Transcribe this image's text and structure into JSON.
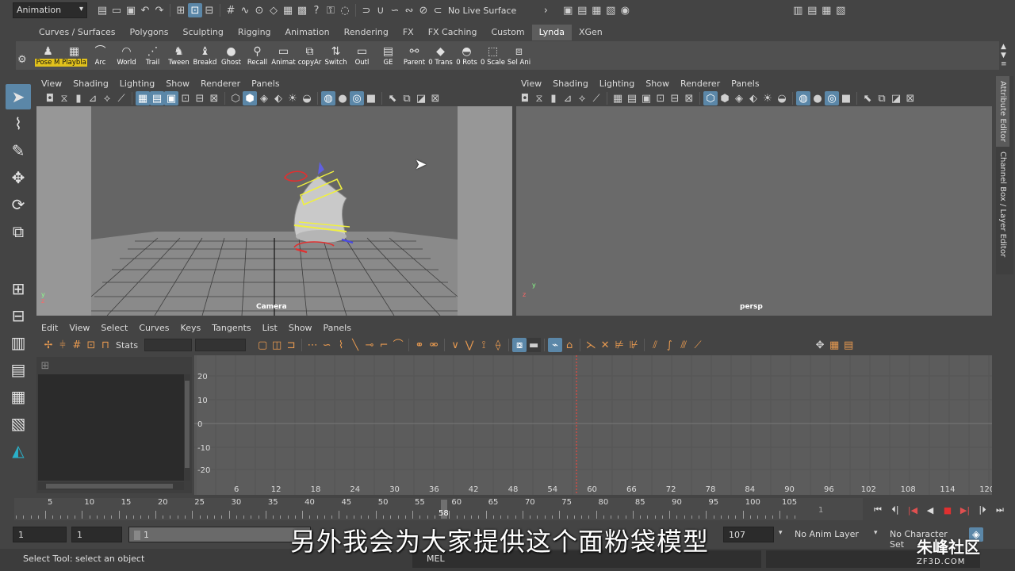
{
  "status_line": {
    "mode": "Animation",
    "live_surface": "No Live Surface"
  },
  "shelf": {
    "tabs": [
      "Curves / Surfaces",
      "Polygons",
      "Sculpting",
      "Rigging",
      "Animation",
      "Rendering",
      "FX",
      "FX Caching",
      "Custom",
      "Lynda",
      "XGen"
    ],
    "active_tab": "Lynda",
    "buttons": [
      "Pose M",
      "Playbla",
      "Arc",
      "World",
      "Trail",
      "Tween",
      "Breakd",
      "Ghost",
      "Recall",
      "Animat",
      "copyAr",
      "Switch",
      "Outl",
      "GE",
      "Parent",
      "0 Trans",
      "0 Rots",
      "0 Scale",
      "Sel Ani"
    ]
  },
  "left_panel": {
    "menu": [
      "View",
      "Shading",
      "Lighting",
      "Show",
      "Renderer",
      "Panels"
    ],
    "camera_label": "Camera"
  },
  "right_panel": {
    "menu": [
      "View",
      "Shading",
      "Lighting",
      "Show",
      "Renderer",
      "Panels"
    ],
    "camera_label": "persp"
  },
  "side_tabs": [
    "Attribute Editor",
    "Channel Box / Layer Editor"
  ],
  "graph_editor": {
    "menu": [
      "Edit",
      "View",
      "Select",
      "Curves",
      "Keys",
      "Tangents",
      "List",
      "Show",
      "Panels"
    ],
    "stats_label": "Stats",
    "y_labels": [
      "20",
      "10",
      "0",
      "-10",
      "-20"
    ],
    "x_labels": [
      "6",
      "12",
      "18",
      "24",
      "30",
      "36",
      "42",
      "48",
      "54",
      "60",
      "66",
      "72",
      "78",
      "84",
      "90",
      "96",
      "102",
      "108",
      "114",
      "120"
    ]
  },
  "time_slider": {
    "labels": [
      "5",
      "10",
      "15",
      "20",
      "25",
      "30",
      "35",
      "40",
      "45",
      "50",
      "55",
      "60",
      "65",
      "70",
      "75",
      "80",
      "85",
      "90",
      "95",
      "100",
      "105"
    ],
    "current_frame": "58",
    "current_frame_field": "1"
  },
  "range_slider": {
    "start": "1",
    "playback_start": "1",
    "range_label": "1",
    "end": "107",
    "anim_layer": "No Anim Layer",
    "character_set": "No Character Set"
  },
  "help_line": {
    "text": "Select Tool: select an object",
    "script_lang": "MEL"
  },
  "overlay": {
    "subtitle": "另外我会为大家提供这个面粉袋模型",
    "watermark_main": "朱峰社区",
    "watermark_sub": "ZF3D.COM"
  }
}
